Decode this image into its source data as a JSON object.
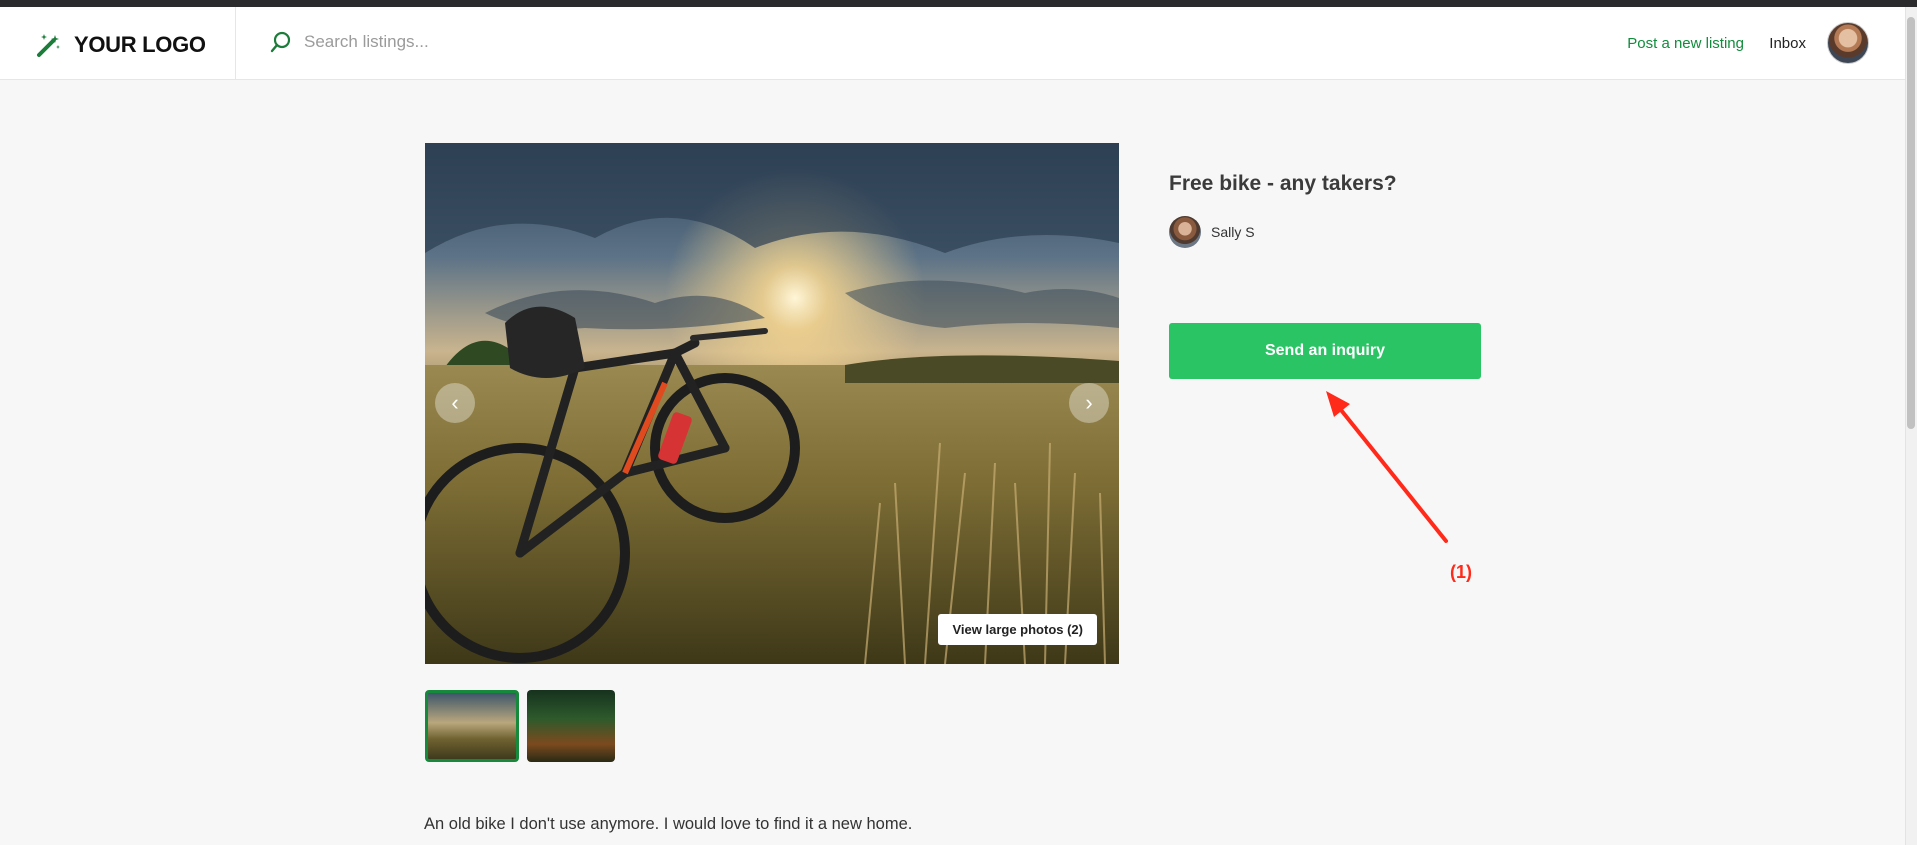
{
  "header": {
    "logo_text": "YOUR LOGO",
    "search_placeholder": "Search listings...",
    "post_listing_label": "Post a new listing",
    "inbox_label": "Inbox"
  },
  "gallery": {
    "view_large_label": "View large photos (2)",
    "thumbnails": [
      "bike-in-field-thumbnail",
      "forest-rider-thumbnail"
    ]
  },
  "listing": {
    "title": "Free bike - any takers?",
    "author_name": "Sally S",
    "inquiry_label": "Send an inquiry",
    "description": "An old bike I don't use anymore. I would love to find it a new home."
  },
  "annotation": {
    "label": "(1)",
    "color": "#ff2a1a"
  },
  "colors": {
    "brand_green": "#118c3c",
    "button_green": "#2ac465"
  }
}
